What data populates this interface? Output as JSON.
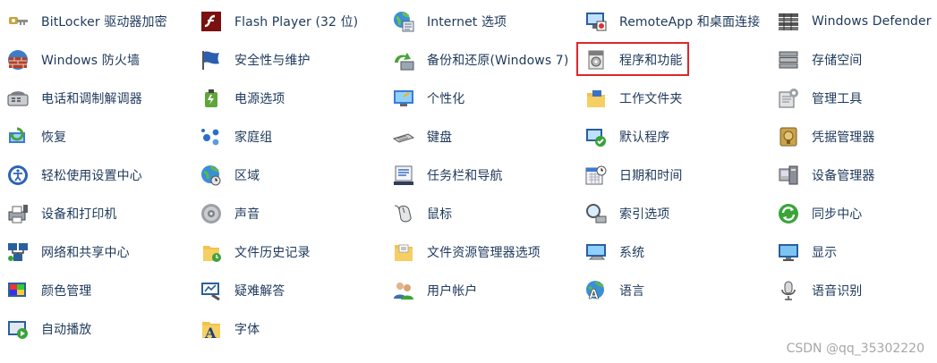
{
  "items": [
    {
      "label": "BitLocker 驱动器加密",
      "icon": "bitlocker-key-icon"
    },
    {
      "label": "Flash Player (32 位)",
      "icon": "flash-player-icon"
    },
    {
      "label": "Internet 选项",
      "icon": "internet-options-icon"
    },
    {
      "label": "RemoteApp 和桌面连接",
      "icon": "remoteapp-icon"
    },
    {
      "label": "Windows Defender",
      "icon": "windows-defender-icon"
    },
    {
      "label": "Windows 防火墙",
      "icon": "firewall-icon"
    },
    {
      "label": "安全性与维护",
      "icon": "security-flag-icon"
    },
    {
      "label": "备份和还原(Windows 7)",
      "icon": "backup-restore-icon"
    },
    {
      "label": "程序和功能",
      "icon": "programs-features-icon",
      "highlight": true
    },
    {
      "label": "存储空间",
      "icon": "storage-spaces-icon"
    },
    {
      "label": "电话和调制解调器",
      "icon": "phone-modem-icon"
    },
    {
      "label": "电源选项",
      "icon": "power-options-icon"
    },
    {
      "label": "个性化",
      "icon": "personalization-icon"
    },
    {
      "label": "工作文件夹",
      "icon": "work-folders-icon"
    },
    {
      "label": "管理工具",
      "icon": "admin-tools-icon"
    },
    {
      "label": "恢复",
      "icon": "recovery-icon"
    },
    {
      "label": "家庭组",
      "icon": "homegroup-icon"
    },
    {
      "label": "键盘",
      "icon": "keyboard-icon"
    },
    {
      "label": "默认程序",
      "icon": "default-programs-icon"
    },
    {
      "label": "凭据管理器",
      "icon": "credential-manager-icon"
    },
    {
      "label": "轻松使用设置中心",
      "icon": "ease-of-access-icon"
    },
    {
      "label": "区域",
      "icon": "region-globe-icon"
    },
    {
      "label": "任务栏和导航",
      "icon": "taskbar-navigation-icon"
    },
    {
      "label": "日期和时间",
      "icon": "date-time-icon"
    },
    {
      "label": "设备管理器",
      "icon": "device-manager-icon"
    },
    {
      "label": "设备和打印机",
      "icon": "devices-printers-icon"
    },
    {
      "label": "声音",
      "icon": "sound-speaker-icon"
    },
    {
      "label": "鼠标",
      "icon": "mouse-icon"
    },
    {
      "label": "索引选项",
      "icon": "indexing-options-icon"
    },
    {
      "label": "同步中心",
      "icon": "sync-center-icon"
    },
    {
      "label": "网络和共享中心",
      "icon": "network-sharing-icon"
    },
    {
      "label": "文件历史记录",
      "icon": "file-history-icon"
    },
    {
      "label": "文件资源管理器选项",
      "icon": "file-explorer-options-icon"
    },
    {
      "label": "系统",
      "icon": "system-icon"
    },
    {
      "label": "显示",
      "icon": "display-monitor-icon"
    },
    {
      "label": "颜色管理",
      "icon": "color-management-icon"
    },
    {
      "label": "疑难解答",
      "icon": "troubleshooting-icon"
    },
    {
      "label": "用户帐户",
      "icon": "user-accounts-icon"
    },
    {
      "label": "语言",
      "icon": "language-icon"
    },
    {
      "label": "语音识别",
      "icon": "speech-recognition-icon"
    },
    {
      "label": "自动播放",
      "icon": "autoplay-icon"
    },
    {
      "label": "字体",
      "icon": "fonts-icon"
    }
  ],
  "watermark": "CSDN @qq_35302220",
  "colors": {
    "label": "#1e395b",
    "highlight_border": "#e0262b",
    "watermark": "#a7a7a7"
  }
}
